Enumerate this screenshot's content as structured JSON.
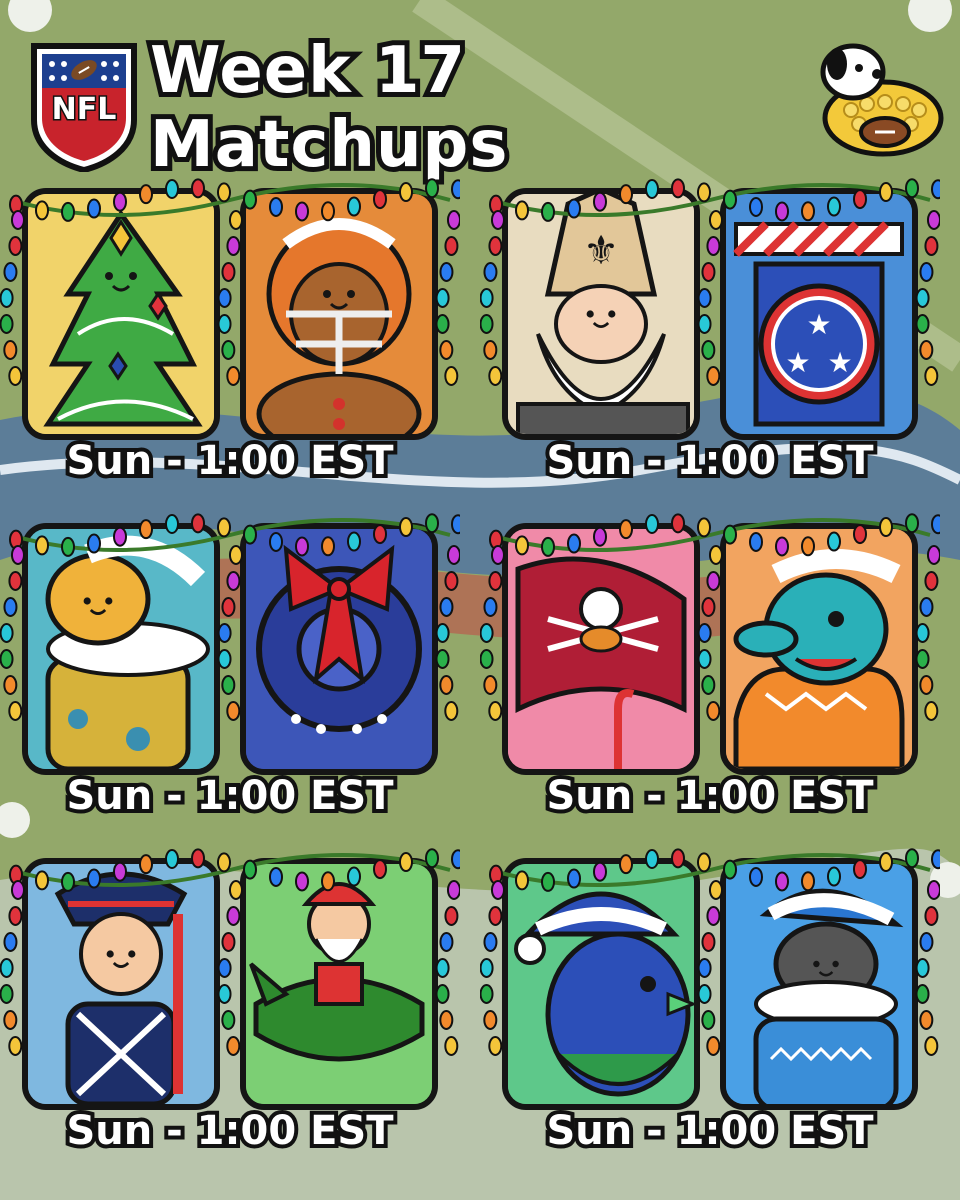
{
  "header": {
    "title": "Week 17 Matchups",
    "logo_text": "NFL"
  },
  "colors": {
    "background": "#93a86a",
    "outline": "#151515",
    "title_fill": "#ffffff"
  },
  "matchups": [
    {
      "time": "Sun - 1:00 EST",
      "left": {
        "icon": "christmas-tree-icon",
        "bg": "#f1d36a"
      },
      "right": {
        "icon": "gingerbread-football-player-icon",
        "bg": "#e58b3a"
      }
    },
    {
      "time": "Sun - 1:00 EST",
      "left": {
        "icon": "bishop-saint-nicholas-icon",
        "bg": "#e8dcc0"
      },
      "right": {
        "icon": "shield-stars-icon",
        "bg": "#4a8fd8"
      }
    },
    {
      "time": "Sun - 1:00 EST",
      "left": {
        "icon": "jaguar-in-stocking-icon",
        "bg": "#58b8c8"
      },
      "right": {
        "icon": "wreath-with-bow-icon",
        "bg": "#3d56b8"
      }
    },
    {
      "time": "Sun - 1:00 EST",
      "left": {
        "icon": "pirate-flag-icon",
        "bg": "#f08aa8"
      },
      "right": {
        "icon": "dolphin-in-sweater-icon",
        "bg": "#f2a460"
      }
    },
    {
      "time": "Sun - 1:00 EST",
      "left": {
        "icon": "patriot-soldier-icon",
        "bg": "#7fb8e0"
      },
      "right": {
        "icon": "santa-in-plane-icon",
        "bg": "#7ccf74"
      }
    },
    {
      "time": "Sun - 1:00 EST",
      "left": {
        "icon": "blue-bird-in-hat-icon",
        "bg": "#5ec88a"
      },
      "right": {
        "icon": "cat-in-stocking-icon",
        "bg": "#4aa0e6"
      }
    }
  ]
}
